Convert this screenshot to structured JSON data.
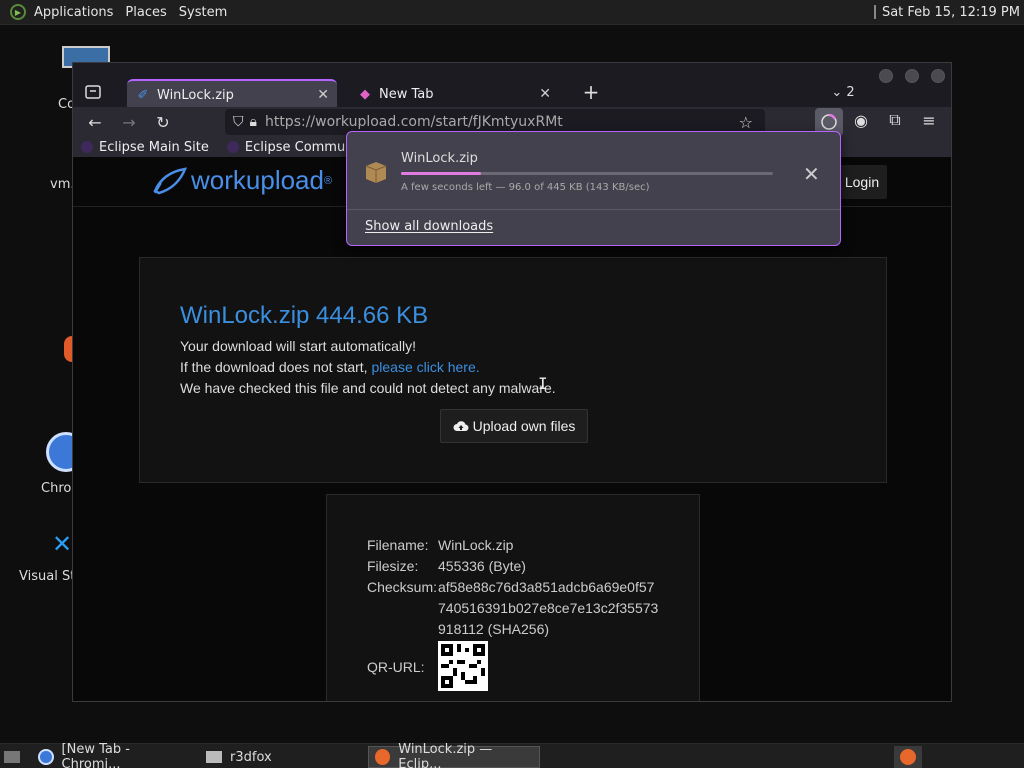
{
  "topbar": {
    "menus": [
      "Applications",
      "Places",
      "System"
    ],
    "clock": "Sat Feb 15, 12:19 PM"
  },
  "desktop": {
    "icons": [
      "Co",
      "vm.",
      "Chro",
      "Visual Str"
    ]
  },
  "browser": {
    "tabs": [
      {
        "label": "WinLock.zip",
        "close": "✕"
      },
      {
        "label": "New Tab",
        "close": "✕"
      }
    ],
    "tab_count": "2",
    "url": "https://workupload.com/start/fJKmtyuxRMt",
    "url_domain": "workupload.com",
    "bookmarks": [
      "Eclipse Main Site",
      "Eclipse Community"
    ]
  },
  "site": {
    "brand": "workupload",
    "login": "Login",
    "title": "WinLock.zip 444.66 KB",
    "line1": "Your download will start automatically!",
    "line2_pre": "If the download does not start, ",
    "line2_link": "please click here.",
    "line3": "We have checked this file and could not detect any malware.",
    "upload_button": "Upload own files",
    "details": {
      "filename_label": "Filename:",
      "filename": "WinLock.zip",
      "filesize_label": "Filesize:",
      "filesize": "455336 (Byte)",
      "checksum_label": "Checksum:",
      "checksum_lines": [
        "af58e88c76d3a851adcb6a69e0f57",
        "740516391b027e8ce7e13c2f35573",
        "918112 (SHA256)"
      ],
      "qr_label": "QR-URL:"
    }
  },
  "download_panel": {
    "filename": "WinLock.zip",
    "progress": 0.216,
    "status": "A few seconds left — 96.0 of 445 KB (143 KB/sec)",
    "show_all": "Show all downloads"
  },
  "taskbar": {
    "items": [
      "[New Tab - Chromi...",
      "r3dfox",
      "WinLock.zip — Eclip..."
    ]
  },
  "colors": {
    "accent": "#b565ff",
    "link": "#3b8fe0",
    "progress": "#e07bdf"
  }
}
